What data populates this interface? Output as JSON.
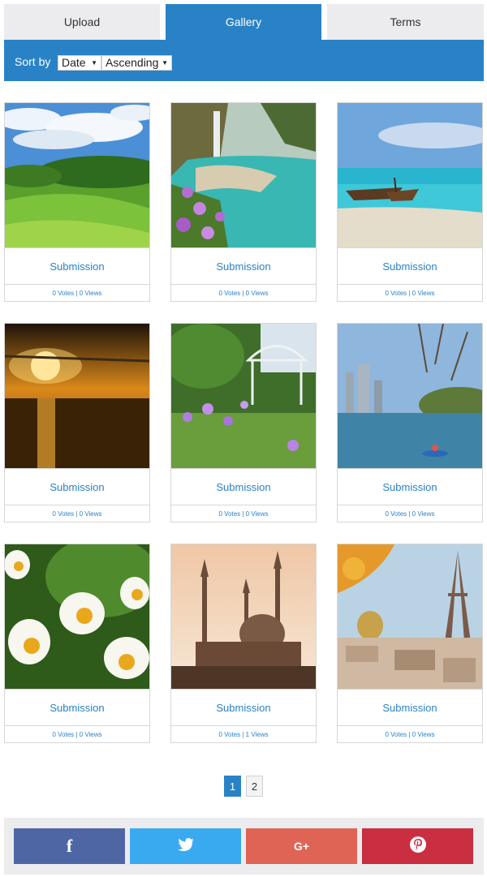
{
  "tabs": [
    {
      "label": "Upload"
    },
    {
      "label": "Gallery",
      "active": true
    },
    {
      "label": "Terms"
    }
  ],
  "sort": {
    "label": "Sort by",
    "field_value": "Date",
    "order_value": "Ascending"
  },
  "cards": [
    {
      "title": "Submission",
      "stats": "0 Votes | 0 Views",
      "image": "green-meadow-photo"
    },
    {
      "title": "Submission",
      "stats": "0 Votes | 0 Views",
      "image": "waterfall-cove-photo"
    },
    {
      "title": "Submission",
      "stats": "0 Votes | 0 Views",
      "image": "tropical-beach-boats-photo"
    },
    {
      "title": "Submission",
      "stats": "0 Votes | 0 Views",
      "image": "sunset-sea-photo"
    },
    {
      "title": "Submission",
      "stats": "0 Votes | 0 Views",
      "image": "garden-gazebo-photo"
    },
    {
      "title": "Submission",
      "stats": "0 Votes | 0 Views",
      "image": "lake-kayaks-city-photo"
    },
    {
      "title": "Submission",
      "stats": "0 Votes | 0 Views",
      "image": "daisies-photo"
    },
    {
      "title": "Submission",
      "stats": "0 Votes | 1 Views",
      "image": "mosque-skyline-photo"
    },
    {
      "title": "Submission",
      "stats": "0 Votes | 0 Views",
      "image": "eiffel-tower-paris-photo"
    }
  ],
  "pagination": {
    "current": "1",
    "next": "2"
  },
  "share": [
    {
      "icon": "facebook-icon",
      "glyph": "f",
      "color": "#4e67a4"
    },
    {
      "icon": "twitter-icon",
      "glyph": "",
      "color": "#3aaaf0"
    },
    {
      "icon": "google-plus-icon",
      "glyph": "G+",
      "color": "#e06456"
    },
    {
      "icon": "pinterest-icon",
      "glyph": "",
      "color": "#c92f41"
    }
  ],
  "colors": {
    "accent": "#2a82c6",
    "tab_inactive": "#ececee",
    "border": "#d7d7d7"
  }
}
